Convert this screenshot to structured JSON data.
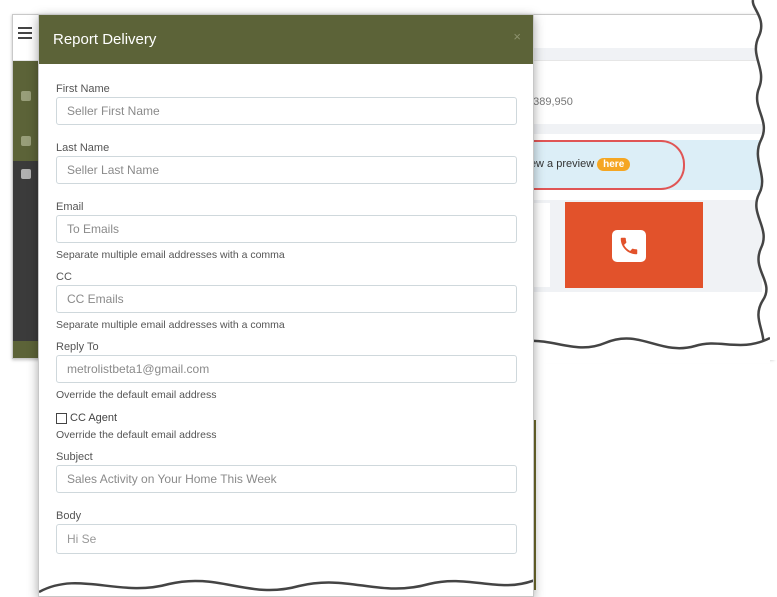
{
  "background": {
    "price": "$389,950",
    "preview_text": "view a preview",
    "here_badge": "here",
    "colors": {
      "sidebar": "#5c6338",
      "phone_tile": "#e2522b",
      "banner": "#dceef7",
      "badge": "#f5a623",
      "highlight_ring": "#e05555"
    },
    "icons": [
      "hamburger-icon",
      "phone-icon"
    ]
  },
  "modal": {
    "title": "Report Delivery",
    "close": "×",
    "fields": {
      "first_name": {
        "label": "First Name",
        "placeholder": "Seller First Name"
      },
      "last_name": {
        "label": "Last Name",
        "placeholder": "Seller Last Name"
      },
      "email": {
        "label": "Email",
        "placeholder": "To Emails",
        "help": "Separate multiple email addresses with a comma"
      },
      "cc": {
        "label": "CC",
        "placeholder": "CC Emails",
        "help": "Separate multiple email addresses with a comma"
      },
      "reply_to": {
        "label": "Reply To",
        "placeholder": "metrolistbeta1@gmail.com",
        "help": "Override the default email address"
      },
      "cc_agent": {
        "label": "CC Agent",
        "checked": false,
        "help": "Override the default email address"
      },
      "subject": {
        "label": "Subject",
        "placeholder": "Sales Activity on Your Home This Week"
      },
      "body": {
        "label": "Body",
        "placeholder": "Hi Seller,",
        "visible_fragment": "Hi Se"
      }
    }
  }
}
